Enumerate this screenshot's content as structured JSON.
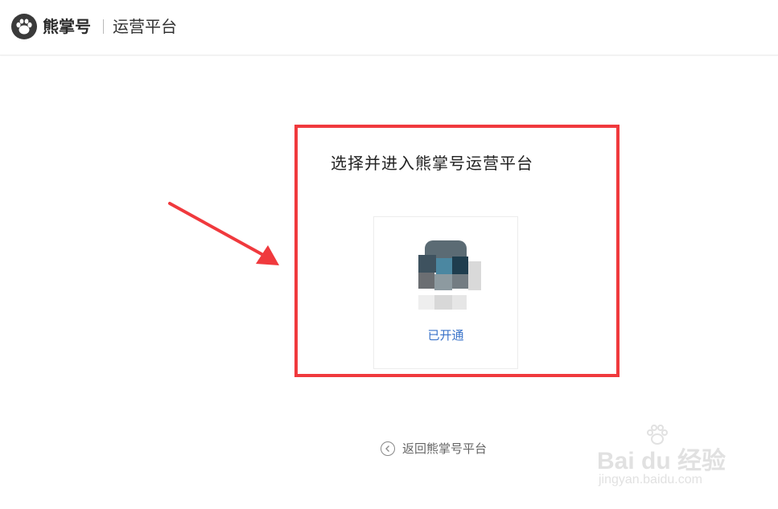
{
  "header": {
    "brand_name": "熊掌号",
    "platform_label": "运营平台"
  },
  "panel": {
    "title": "选择并进入熊掌号运营平台",
    "accounts": [
      {
        "status": "已开通"
      }
    ]
  },
  "footer": {
    "back_label": "返回熊掌号平台"
  },
  "watermark": {
    "main": "Bai du 经验",
    "sub": "jingyan.baidu.com"
  },
  "colors": {
    "highlight": "#f0393d",
    "status_link": "#3a73c9",
    "logo": "#3a3a3a"
  },
  "icons": {
    "logo": "paw-icon",
    "back": "chevron-left-icon",
    "annotation": "arrow-icon"
  }
}
